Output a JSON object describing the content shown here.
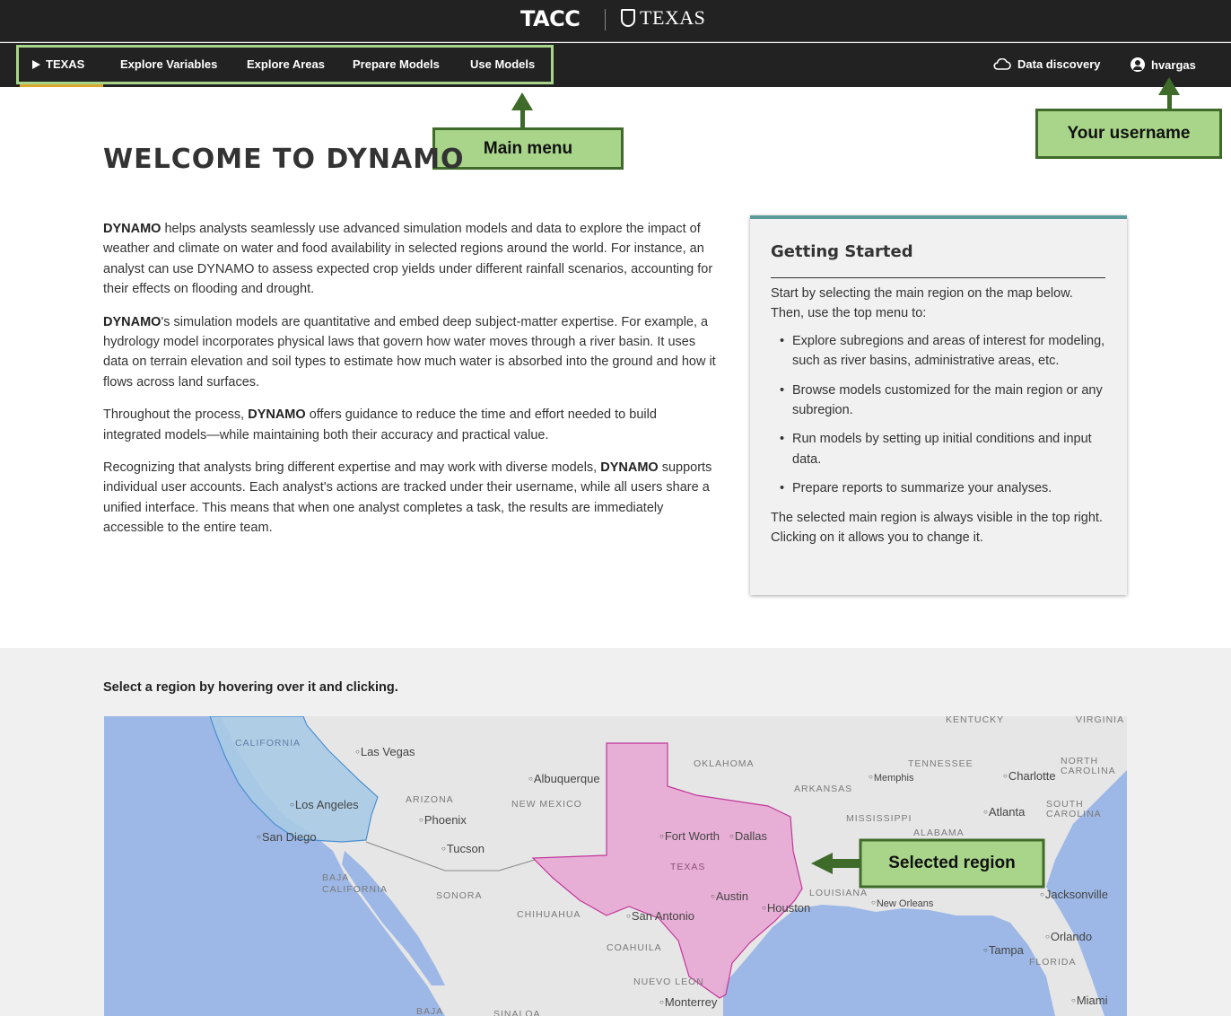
{
  "brand": {
    "tacc": "TACC",
    "texas": "TEXAS"
  },
  "nav": {
    "region": "TEXAS",
    "items": [
      "Explore Variables",
      "Explore Areas",
      "Prepare Models",
      "Use Models"
    ],
    "data_discovery": "Data discovery",
    "username": "hvargas",
    "icons": {
      "region": "play-icon",
      "data_discovery": "cloud-icon",
      "user": "user-circle-icon"
    }
  },
  "callouts": {
    "main_menu": "Main menu",
    "username": "Your username",
    "selected_region": "Selected region",
    "color": "#a8d58a"
  },
  "page": {
    "title": "WELCOME TO DYNAMO",
    "intro": [
      {
        "lead": "DYNAMO",
        "text": " helps analysts seamlessly use advanced simulation models and data to explore the impact of weather and climate on water and food availability in selected regions around the world. For instance, an analyst can use DYNAMO to assess expected crop yields under different rainfall scenarios, accounting for their effects on flooding and drought."
      },
      {
        "lead": "DYNAMO",
        "text": "'s simulation models are quantitative and embed deep subject-matter expertise. For example, a hydrology model incorporates physical laws that govern how water moves through a river basin. It uses data on terrain elevation and soil types to estimate how much water is absorbed into the ground and how it flows across land surfaces."
      },
      {
        "before": "Throughout the process, ",
        "lead": "DYNAMO",
        "text": " offers guidance to reduce the time and effort needed to build integrated models—while maintaining both their accuracy and practical value."
      },
      {
        "before": "Recognizing that analysts bring different expertise and may work with diverse models, ",
        "lead": "DYNAMO",
        "text": " supports individual user accounts. Each analyst's actions are tracked under their username, while all users share a unified interface. This means that when one analyst completes a task, the results are immediately accessible to the entire team."
      }
    ]
  },
  "getting_started": {
    "title": "Getting Started",
    "intro": "Start by selecting the main region on the map below. Then, use the top menu to:",
    "bullets": [
      "Explore subregions and areas of interest for modeling, such as river basins, administrative areas, etc.",
      "Browse models customized for the main region or any subregion.",
      "Run models by setting up initial conditions and input data.",
      "Prepare reports to summarize your analyses."
    ],
    "outro": "The selected main region is always visible in the top right. Clicking on it allows you to change it.",
    "accent": "#5a9a9b"
  },
  "map": {
    "prompt": "Select a region by hovering over it and clicking.",
    "regions": {
      "california": {
        "label": "CALIFORNIA",
        "color": "#a9cbe6"
      },
      "texas": {
        "label": "TEXAS",
        "color": "#e8a8d4",
        "selected": true
      }
    },
    "labels": [
      "KENTUCKY",
      "VIRGINIA",
      "OKLAHOMA",
      "TENNESSEE",
      "NORTH CAROLINA",
      "ARIZONA",
      "NEW MEXICO",
      "ARKANSAS",
      "SOUTH CAROLINA",
      "MISSISSIPPI",
      "ALABAMA",
      "BAJA CALIFORNIA",
      "SONORA",
      "CHIHUAHUA",
      "LOUISIANA",
      "COAHUILA",
      "NUEVO LEON",
      "FLORIDA",
      "BAJA",
      "SINALOA"
    ],
    "cities": [
      "Las Vegas",
      "Albuquerque",
      "Memphis",
      "Charlotte",
      "Los Angeles",
      "Phoenix",
      "Atlanta",
      "San Diego",
      "Tucson",
      "Fort Worth",
      "Dallas",
      "Austin",
      "New Orleans",
      "Jacksonville",
      "San Antonio",
      "Houston",
      "Orlando",
      "Tampa",
      "Monterrey",
      "Miami"
    ],
    "water_color": "#9db8e6",
    "land_color": "#e6e6e6"
  }
}
